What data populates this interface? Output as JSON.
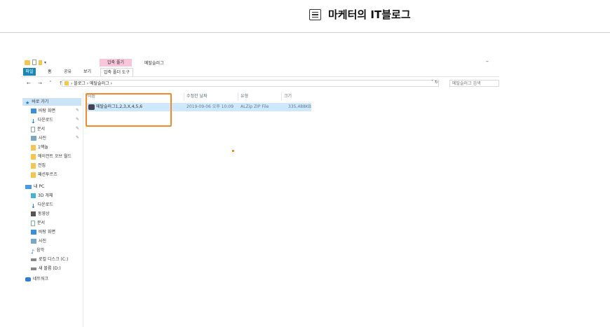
{
  "blog": {
    "title": "마케터의 IT블로그",
    "icon": "list-icon"
  },
  "explorer": {
    "context_tab": "압축 풀기",
    "window_title": "메탈슬러그",
    "minimize": "–",
    "ribbon_tabs": [
      "파일",
      "홈",
      "공유",
      "보기",
      "압축 폴더 도구"
    ],
    "nav_buttons": "←  →  ˅  ↑",
    "address_parts": "› 블로그 › 메탈슬러그 ›",
    "address_controls": "˅ ↻",
    "search_placeholder": "메탈슬러그 검색",
    "columns": [
      "이름",
      "수정한 날짜",
      "유형",
      "크기"
    ],
    "file": {
      "name": "메탈슬러그1,2,3,X,4,5,6",
      "modified": "2019-09-06 오후 10:09",
      "type": "ALZip ZIP File",
      "size": "335,488KB"
    },
    "quick_access": {
      "label": "바로 가기",
      "items": [
        {
          "label": "바탕 화면",
          "pinned": true
        },
        {
          "label": "다운로드",
          "pinned": true
        },
        {
          "label": "문서",
          "pinned": true
        },
        {
          "label": "사진",
          "pinned": true
        },
        {
          "label": "1핵놀",
          "pinned": false
        },
        {
          "label": "에이전트 오브 월드",
          "pinned": false
        },
        {
          "label": "전집",
          "pinned": false
        },
        {
          "label": "패션투르즈",
          "pinned": false
        }
      ]
    },
    "this_pc": {
      "label": "내 PC",
      "items": [
        "3D 개체",
        "다운로드",
        "동영상",
        "문서",
        "바탕 화면",
        "사진",
        "음악",
        "로컬 디스크 (C:)",
        "새 볼륨 (D:)"
      ]
    },
    "network": "네트워크",
    "highlight_color": "#f08a2a",
    "accent_color": "#1a86b8"
  }
}
